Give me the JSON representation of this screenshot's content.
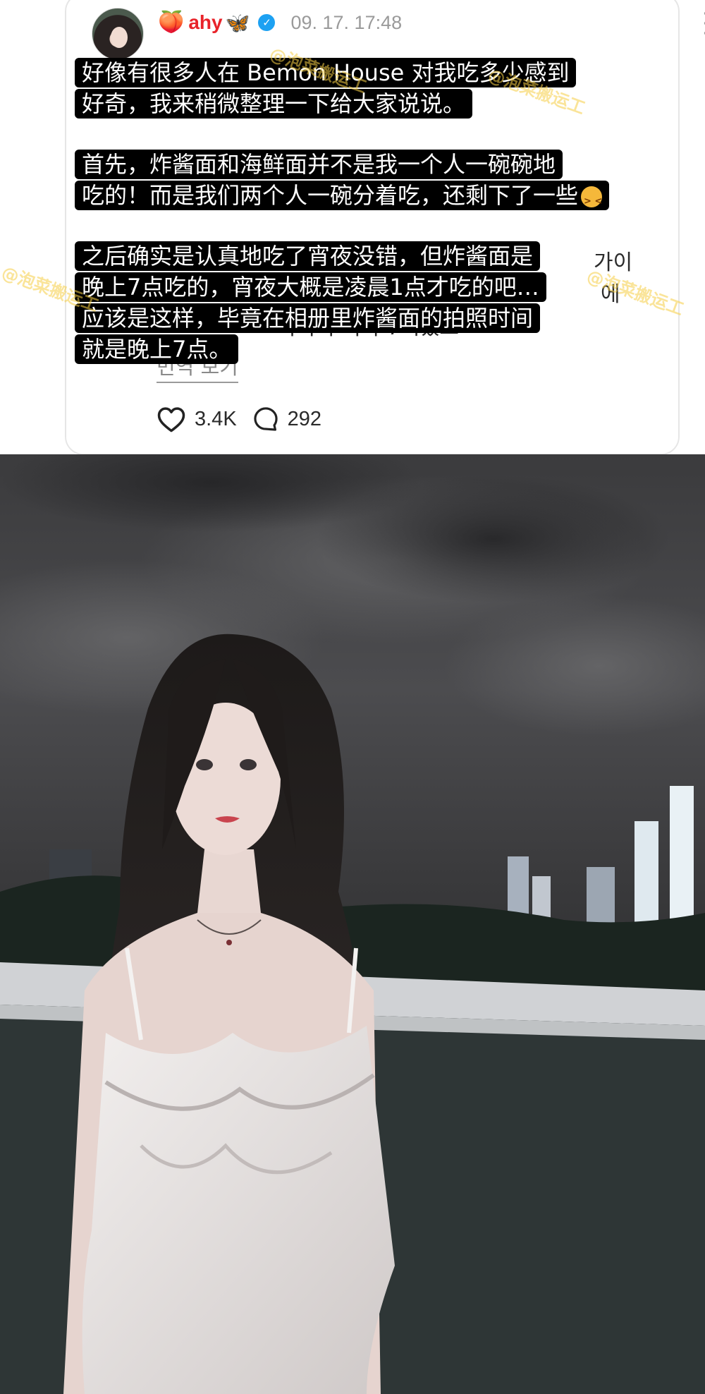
{
  "post": {
    "username": "ahy",
    "badge_left_emoji": "🍑",
    "badge_right_emoji": "🦋",
    "timestamp": "09. 17. 17:48",
    "ko_lines": [
      "에",
      "가이",
      "에",
      "기억이 지각 7시였오"
    ],
    "translate_link": "번역 보기",
    "likes": "3.4K",
    "comments": "292"
  },
  "subtitles": {
    "p1": [
      "好像有很多人在 Bemon House 对我吃多少感到",
      "好奇，我来稍微整理一下给大家说说。"
    ],
    "p2": [
      "首先，炸酱面和海鲜面并不是我一个人一碗碗地",
      "吃的！而是我们两个人一碗分着吃，还剩下了一些"
    ],
    "p3": [
      "之后确实是认真地吃了宵夜没错，但炸酱面是",
      "晚上7点吃的，宵夜大概是凌晨1点才吃的吧…",
      "应该是这样，毕竟在相册里炸酱面的拍照时间",
      "就是晚上7点。"
    ]
  },
  "watermark": "@泡菜搬运工",
  "icons": [
    "more-vert-icon",
    "heart-icon",
    "comment-icon",
    "verified-icon"
  ],
  "colors": {
    "username": "#e8232a",
    "verified": "#1da1f2",
    "subtitle_bg": "#000000"
  }
}
